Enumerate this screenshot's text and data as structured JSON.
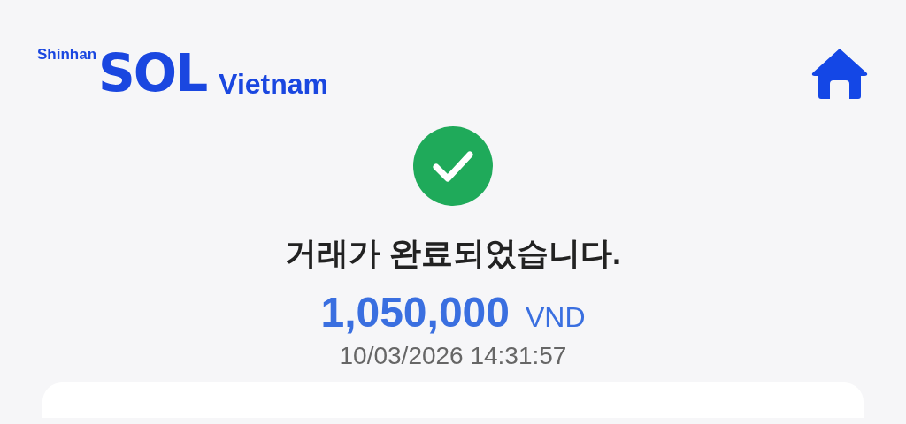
{
  "header": {
    "brand_prefix": "Shinhan",
    "brand_logo": "SOL",
    "brand_suffix": "Vietnam"
  },
  "result": {
    "completed": true,
    "message": "거래가 완료되었습니다.",
    "amount": "1,050,000",
    "currency": "VND",
    "timestamp": "10/03/2026 14:31:57"
  }
}
